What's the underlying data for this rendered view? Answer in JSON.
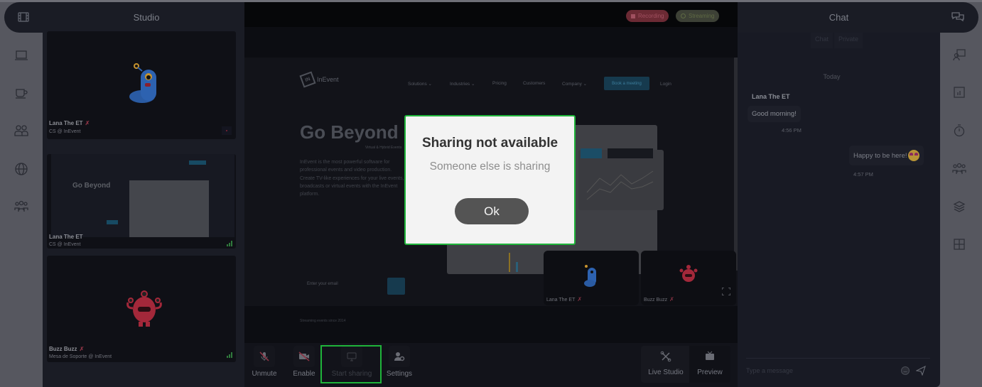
{
  "studio": {
    "title": "Studio",
    "participants": [
      {
        "name": "Lana The ET",
        "role": "CS @ InEvent",
        "muted": true,
        "avatar_color": "#2b5ea8"
      },
      {
        "name": "Lana The ET",
        "role": "CS @ InEvent",
        "muted": false,
        "screen_share": true
      },
      {
        "name": "Buzz Buzz",
        "role": "Mesa de Soporte @ InEvent",
        "muted": true,
        "avatar_color": "#a62a34"
      }
    ]
  },
  "left_rail": {
    "icons": [
      "film-icon",
      "laptop-icon",
      "coffee-icon",
      "users-icon",
      "globe-icon",
      "group-icon"
    ]
  },
  "stage": {
    "badges": {
      "recording": "Recording",
      "streaming": "Streaming"
    },
    "shared_site": {
      "brand": "InEvent",
      "nav": [
        "Solutions ⌄",
        "Industries ⌄",
        "Pricing",
        "Customers",
        "Company ⌄"
      ],
      "cta": "Book a meeting",
      "login": "Login",
      "hero_title": "Go Beyond",
      "hero_sub": "Virtual & Hybrid Events",
      "hero_body": "InEvent is the most powerful software for professional events and video production. Create TV-like experiences for your live events, broadcasts or virtual events with the InEvent platform.",
      "email_placeholder": "Enter your email",
      "since": "Streaming events since 2014"
    },
    "cameras": [
      {
        "name": "Lana The ET",
        "muted": true
      },
      {
        "name": "Buzz Buzz",
        "muted": true
      }
    ]
  },
  "controls": {
    "unmute": "Unmute",
    "enable": "Enable",
    "start_sharing": "Start sharing",
    "settings": "Settings",
    "live_studio": "Live Studio",
    "preview": "Preview"
  },
  "chat": {
    "title": "Chat",
    "tabs": [
      "Chat",
      "Private"
    ],
    "day_label": "Today",
    "messages": [
      {
        "sender": "Lana The ET",
        "text": "Good morning!",
        "time": "4:56 PM"
      },
      {
        "sender": "me",
        "text": "Happy to be here!",
        "time": "4:57 PM",
        "emoji": "star-struck"
      }
    ],
    "input_placeholder": "Type a message"
  },
  "right_rail": {
    "icons": [
      "chat-icon",
      "presenter-icon",
      "poll-icon",
      "timer-icon",
      "attendees-icon",
      "layers-icon",
      "layout-icon"
    ]
  },
  "modal": {
    "title": "Sharing not available",
    "message": "Someone else is sharing",
    "ok_label": "Ok"
  },
  "colors": {
    "highlight": "#1fb43a",
    "recording": "#6b2a34",
    "streaming": "#3d4136"
  }
}
